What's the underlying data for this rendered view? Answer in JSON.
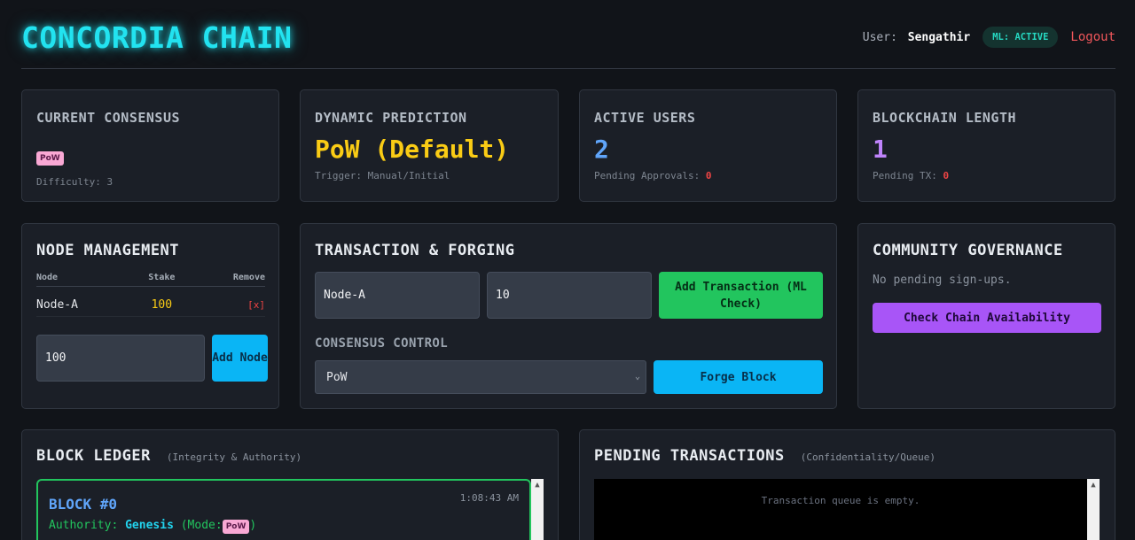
{
  "header": {
    "brand": "CONCORDIA CHAIN",
    "user_prefix": "User:",
    "user_name": "Sengathir",
    "ml_badge": "ML: ACTIVE",
    "logout": "Logout"
  },
  "stats": {
    "consensus": {
      "title": "CURRENT CONSENSUS",
      "mode": "PoW",
      "difficulty": "Difficulty: 3"
    },
    "prediction": {
      "title": "DYNAMIC PREDICTION",
      "value": "PoW (Default)",
      "trigger": "Trigger: Manual/Initial"
    },
    "users": {
      "title": "ACTIVE USERS",
      "value": "2",
      "pending_label": "Pending Approvals:",
      "pending_count": "0"
    },
    "length": {
      "title": "BLOCKCHAIN LENGTH",
      "value": "1",
      "pending_label": "Pending TX:",
      "pending_count": "0"
    }
  },
  "node_management": {
    "title": "NODE MANAGEMENT",
    "columns": [
      "Node",
      "Stake",
      "Remove"
    ],
    "rows": [
      {
        "node": "Node-A",
        "stake": "100",
        "remove": "[x]"
      }
    ],
    "stake_input": "100",
    "add_button": "Add Node"
  },
  "transaction": {
    "title": "TRANSACTION & FORGING",
    "node_input": "Node-A",
    "amount_input": "10",
    "add_button": "Add Transaction (ML Check)",
    "consensus_label": "CONSENSUS CONTROL",
    "consensus_selected": "PoW",
    "forge_button": "Forge Block"
  },
  "governance": {
    "title": "COMMUNITY GOVERNANCE",
    "empty_text": "No pending sign-ups.",
    "check_button": "Check Chain Availability"
  },
  "ledger": {
    "title": "BLOCK LEDGER",
    "subtitle": "(Integrity & Authority)",
    "block": {
      "label": "BLOCK #0",
      "time": "1:08:43 AM",
      "authority_label": "Authority:",
      "authority_value": "Genesis",
      "mode_prefix": "(Mode:",
      "mode": "PoW",
      "mode_suffix": ")"
    }
  },
  "pending": {
    "title": "PENDING TRANSACTIONS",
    "subtitle": "(Confidentiality/Queue)",
    "empty_text": "Transaction queue is empty."
  },
  "colors": {
    "brand": "#22e3f0",
    "prediction": "#facc15",
    "users": "#60a5fa",
    "length": "#c084fc",
    "block_label": "#60a5fa",
    "authority": "#22c55e",
    "genesis": "#22d3ee"
  },
  "icons": {
    "select_chevron": "chevron-down-icon",
    "remove": "[x]",
    "scroll_up": "triangle-up-icon"
  }
}
